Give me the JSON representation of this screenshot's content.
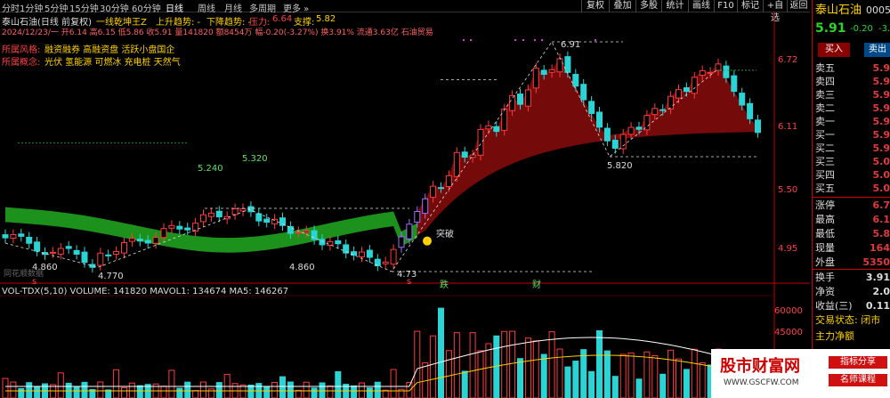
{
  "toolbar": {
    "periods": [
      "分时",
      "1分钟",
      "5分钟",
      "15分钟",
      "30分钟",
      "60分钟",
      "日线",
      "周线",
      "月线",
      "多周期",
      "更多"
    ],
    "active_period": "日线",
    "right_buttons": [
      "复权",
      "叠加",
      "多股",
      "统计",
      "画线",
      "F10",
      "标记",
      "+自选",
      "返回"
    ]
  },
  "header": {
    "stock_name": "泰山石油(日线 前复权)",
    "indicator": "一线乾坤王Z",
    "uptrend": "上升趋势: -",
    "downtrend": "下降趋势: -",
    "pressure_label": "压力:",
    "pressure_value": "6.64",
    "support_label": "支撑:",
    "support_value": "5.82",
    "info_line": "2024/12/23/一 开6.14 高6.15 低5.86 收5.91 量141820 额8454万 幅-0.20(-3.27%) 换3.91% 流通3.63亿 石油贸易",
    "style_label": "所属风格:",
    "style_value": "融资融券 高融资盘 活跃小盘国企",
    "concept_label": "所属概念:",
    "concept_value": "光伏 氢能源 可燃冰 充电桩 天然气"
  },
  "price_labels": {
    "p691": "6.91",
    "p5820": "5.820",
    "p5320": "5.320",
    "p5240": "5.240",
    "p4860a": "4.860",
    "p4860b": "4.860",
    "p4770": "4.770",
    "p4730": "4.73",
    "tu_po": "突破",
    "mark_die": "跌",
    "mark_cai": "财",
    "mark_s": "s",
    "mark_s2": "s",
    "watermark": "同花顺数据"
  },
  "y_axis": [
    "6.72",
    "6.11",
    "5.50",
    "4.95"
  ],
  "volume": {
    "header": "VOL-TDX(5,10)  VOLUME: 141820  MAVOL1: 134674  MA5: 146267",
    "axis": [
      "60000",
      "45000"
    ]
  },
  "sidebar": {
    "title": "泰山石油",
    "code": "0005",
    "price": "5.91",
    "change": "-0.20",
    "pct": "-3.",
    "buy_btn": "买入",
    "sell_btn": "卖出",
    "levels": [
      {
        "label": "卖五",
        "value": "5.9"
      },
      {
        "label": "卖四",
        "value": "5.9"
      },
      {
        "label": "卖三",
        "value": "5.9"
      },
      {
        "label": "卖二",
        "value": "5.9"
      },
      {
        "label": "卖一",
        "value": "5.9"
      },
      {
        "label": "买一",
        "value": "5.9"
      },
      {
        "label": "买二",
        "value": "5.9"
      },
      {
        "label": "买三",
        "value": "5.0"
      },
      {
        "label": "买四",
        "value": "5.0"
      },
      {
        "label": "买五",
        "value": "5.0"
      }
    ],
    "stats": [
      {
        "label": "涨停",
        "value": "6.7"
      },
      {
        "label": "最高",
        "value": "6.1"
      },
      {
        "label": "最低",
        "value": "5.8"
      },
      {
        "label": "现量",
        "value": "164"
      },
      {
        "label": "外盘",
        "value": "5350"
      }
    ],
    "stats2": [
      {
        "label": "换手",
        "value": "3.91"
      },
      {
        "label": "净资",
        "value": "2.0"
      },
      {
        "label": "收益(三)",
        "value": "0.11"
      }
    ],
    "trade_status": "交易状态: 闭市",
    "main_flow": "主力净额",
    "brand1": "股市财富网",
    "brand2": "WWW.GSCFW.COM",
    "tag1": "指标分享",
    "tag2": "名师课程"
  },
  "colors": {
    "up": "#ff3b3b",
    "down": "#2ad4d4",
    "green_band": "#1e9a1e",
    "red_band": "#7a0b0b",
    "axis": "#c00000",
    "yellow": "#ffd200",
    "purple": "#a070ff"
  }
}
